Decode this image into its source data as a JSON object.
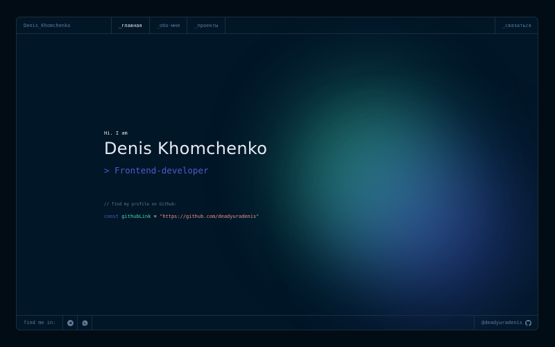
{
  "header": {
    "brand": "Denis_Khomchenko",
    "tabs": [
      {
        "label": "_главная"
      },
      {
        "label": "_обо-мне"
      },
      {
        "label": "_проекты"
      }
    ],
    "contact": "_связаться"
  },
  "hero": {
    "greeting": "Hi. I am",
    "name": "Denis Khomchenko",
    "role": "> Frontend-developer",
    "comment": "// find my profile on Github:",
    "code": {
      "keyword": "const",
      "variable": "githubLink",
      "operator": "=",
      "value": "\"https://github.com/deadyuradenis\""
    }
  },
  "footer": {
    "find_label": "find me in:",
    "socials": [
      {
        "icon": "telegram-icon"
      },
      {
        "icon": "whatsapp-icon"
      }
    ],
    "handle": "@deadyuradenis",
    "handle_icon": "github-icon"
  },
  "colors": {
    "background": "#011627",
    "border": "#1e2d3d",
    "text_muted": "#607b96",
    "text": "#e5e9f0",
    "accent_blue": "#4d5bce",
    "accent_green": "#43d9ad",
    "string": "#e99287"
  }
}
